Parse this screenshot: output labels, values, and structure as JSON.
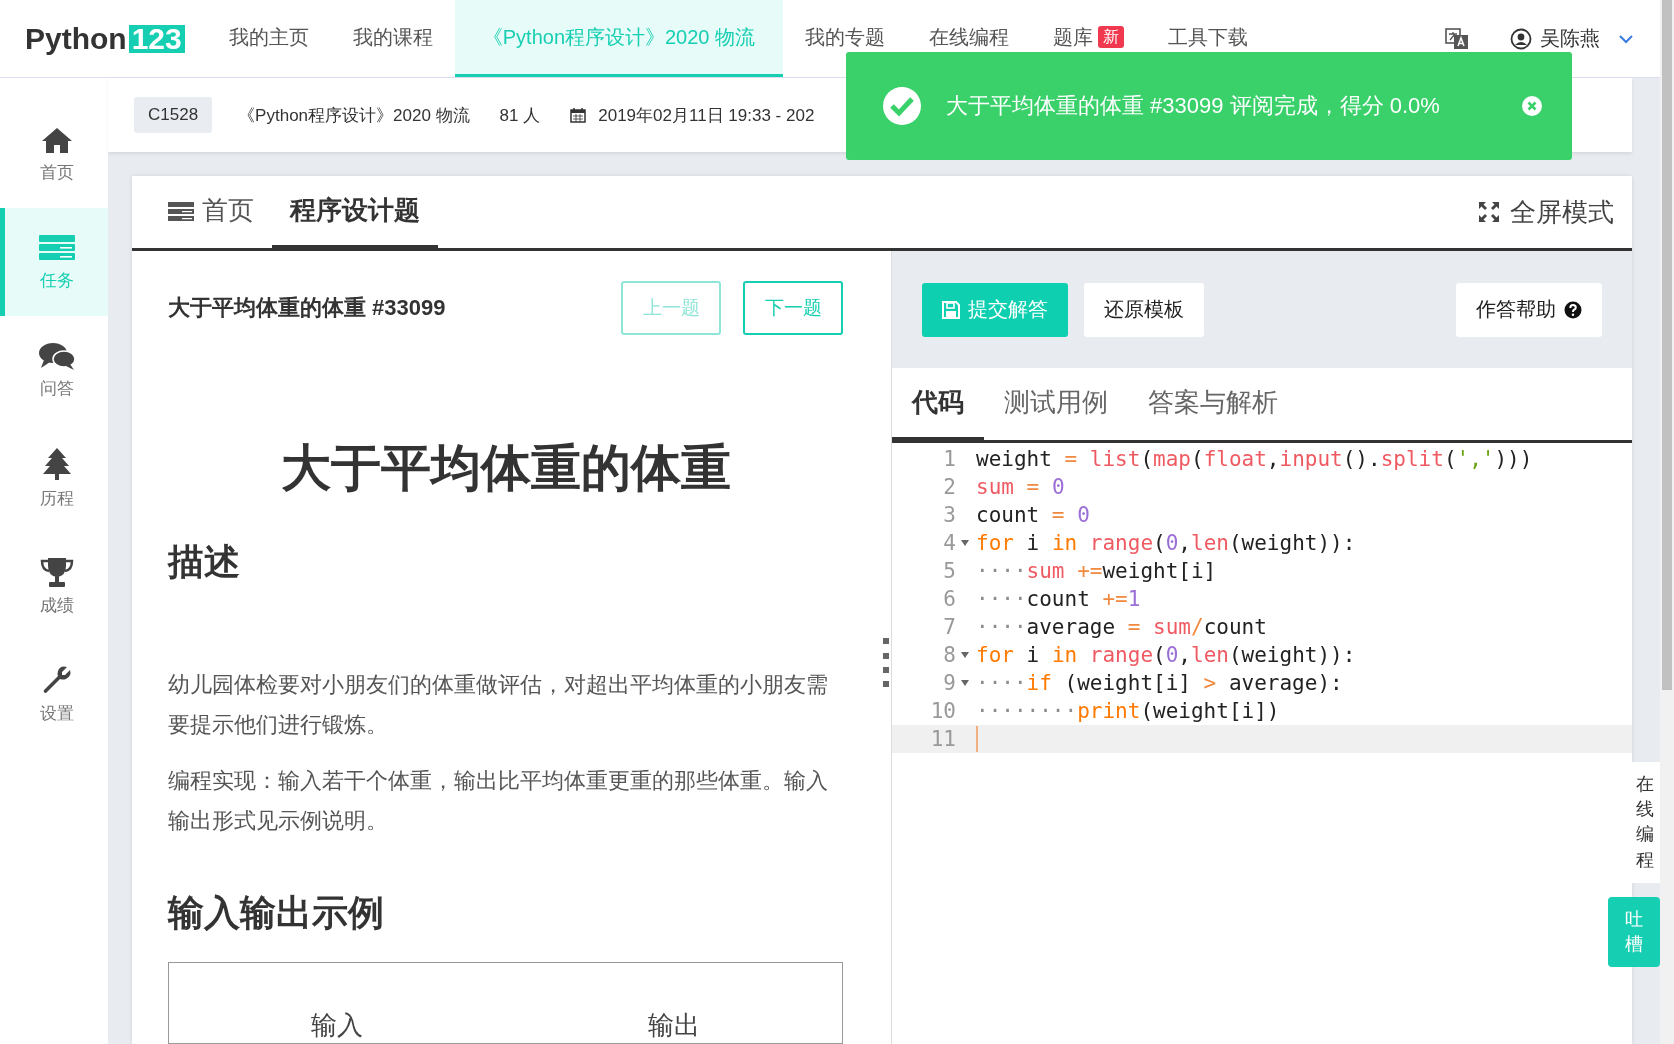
{
  "nav": {
    "logo": {
      "text": "Python",
      "badge": "123"
    },
    "items": [
      {
        "label": "我的主页",
        "selected": false
      },
      {
        "label": "我的课程",
        "selected": false
      },
      {
        "label": "《Python程序设计》2020 物流",
        "selected": true
      },
      {
        "label": "我的专题",
        "selected": false
      },
      {
        "label": "在线编程",
        "selected": false
      },
      {
        "label": "题库",
        "selected": false,
        "badge": "新"
      },
      {
        "label": "工具下载",
        "selected": false
      }
    ],
    "user": {
      "name": "吴陈燕"
    }
  },
  "sidebar": {
    "items": [
      {
        "label": "首页",
        "selected": false
      },
      {
        "label": "任务",
        "selected": true
      },
      {
        "label": "问答",
        "selected": false
      },
      {
        "label": "历程",
        "selected": false
      },
      {
        "label": "成绩",
        "selected": false
      },
      {
        "label": "设置",
        "selected": false
      }
    ]
  },
  "course_bar": {
    "code": "C1528",
    "course": "《Python程序设计》2020 物流",
    "members": "81 人",
    "dates": "2019年02月11日 19:33 - 202"
  },
  "toast": {
    "message": "大于平均体重的体重 #33099 评阅完成，得分 0.0%"
  },
  "card": {
    "tabs": [
      {
        "label": "首页",
        "selected": false
      },
      {
        "label": "程序设计题",
        "selected": true
      }
    ],
    "fullscreen": "全屏模式"
  },
  "problem": {
    "title": "大于平均体重的体重 #33099",
    "prev": {
      "label": "上一题",
      "disabled": true
    },
    "next": {
      "label": "下一题",
      "disabled": false
    },
    "heading": "大于平均体重的体重",
    "sections": [
      {
        "kind": "h2",
        "text": "描述"
      },
      {
        "kind": "p",
        "text": "幼儿园体检要对小朋友们的体重做评估，对超出平均体重的小朋友需要提示他们进行锻炼。"
      },
      {
        "kind": "p",
        "text": "编程实现：输入若干个体重，输出比平均体重更重的那些体重。输入输出形式见示例说明。"
      },
      {
        "kind": "h2",
        "text": "输入输出示例"
      }
    ],
    "example_table": {
      "columns": [
        "输入",
        "输出"
      ]
    }
  },
  "editor": {
    "toolbar": {
      "submit": "提交解答",
      "reset": "还原模板",
      "help": "作答帮助"
    },
    "tabs": [
      {
        "label": "代码",
        "selected": true
      },
      {
        "label": "测试用例",
        "selected": false
      },
      {
        "label": "答案与解析",
        "selected": false
      }
    ],
    "lines": [
      {
        "number": "1",
        "fold": false,
        "active": false,
        "tokens": [
          {
            "text": "weight",
            "kind": "plain"
          },
          {
            "text": " = ",
            "kind": "op"
          },
          {
            "text": "list",
            "kind": "builtin"
          },
          {
            "text": "(",
            "kind": "plain"
          },
          {
            "text": "map",
            "kind": "builtin"
          },
          {
            "text": "(",
            "kind": "plain"
          },
          {
            "text": "float",
            "kind": "builtin"
          },
          {
            "text": ",",
            "kind": "plain"
          },
          {
            "text": "input",
            "kind": "builtin"
          },
          {
            "text": "().",
            "kind": "plain"
          },
          {
            "text": "split",
            "kind": "builtin"
          },
          {
            "text": "(",
            "kind": "plain"
          },
          {
            "text": "','",
            "kind": "string"
          },
          {
            "text": ")))",
            "kind": "plain"
          }
        ]
      },
      {
        "number": "2",
        "fold": false,
        "active": false,
        "tokens": [
          {
            "text": "sum",
            "kind": "builtin"
          },
          {
            "text": " = ",
            "kind": "op"
          },
          {
            "text": "0",
            "kind": "number"
          }
        ]
      },
      {
        "number": "3",
        "fold": false,
        "active": false,
        "tokens": [
          {
            "text": "count",
            "kind": "plain"
          },
          {
            "text": " = ",
            "kind": "op"
          },
          {
            "text": "0",
            "kind": "number"
          }
        ]
      },
      {
        "number": "4",
        "fold": true,
        "active": false,
        "tokens": [
          {
            "text": "for",
            "kind": "keyword"
          },
          {
            "text": " i ",
            "kind": "plain"
          },
          {
            "text": "in",
            "kind": "keyword"
          },
          {
            "text": " range",
            "kind": "builtin"
          },
          {
            "text": "(",
            "kind": "plain"
          },
          {
            "text": "0",
            "kind": "number"
          },
          {
            "text": ",",
            "kind": "plain"
          },
          {
            "text": "len",
            "kind": "builtin"
          },
          {
            "text": "(weight)):",
            "kind": "plain"
          }
        ]
      },
      {
        "number": "5",
        "fold": false,
        "active": false,
        "tokens": [
          {
            "text": "····",
            "kind": "whitespace"
          },
          {
            "text": "sum",
            "kind": "builtin"
          },
          {
            "text": " +=",
            "kind": "op"
          },
          {
            "text": "weight[i]",
            "kind": "plain"
          }
        ]
      },
      {
        "number": "6",
        "fold": false,
        "active": false,
        "tokens": [
          {
            "text": "····",
            "kind": "whitespace"
          },
          {
            "text": "count",
            "kind": "plain"
          },
          {
            "text": " +=",
            "kind": "op"
          },
          {
            "text": "1",
            "kind": "number"
          }
        ]
      },
      {
        "number": "7",
        "fold": false,
        "active": false,
        "tokens": [
          {
            "text": "····",
            "kind": "whitespace"
          },
          {
            "text": "average",
            "kind": "plain"
          },
          {
            "text": " = ",
            "kind": "op"
          },
          {
            "text": "sum",
            "kind": "builtin"
          },
          {
            "text": "/",
            "kind": "op"
          },
          {
            "text": "count",
            "kind": "plain"
          }
        ]
      },
      {
        "number": "8",
        "fold": true,
        "active": false,
        "tokens": [
          {
            "text": "for",
            "kind": "keyword"
          },
          {
            "text": " i ",
            "kind": "plain"
          },
          {
            "text": "in",
            "kind": "keyword"
          },
          {
            "text": " range",
            "kind": "builtin"
          },
          {
            "text": "(",
            "kind": "plain"
          },
          {
            "text": "0",
            "kind": "number"
          },
          {
            "text": ",",
            "kind": "plain"
          },
          {
            "text": "len",
            "kind": "builtin"
          },
          {
            "text": "(weight)):",
            "kind": "plain"
          }
        ]
      },
      {
        "number": "9",
        "fold": true,
        "active": false,
        "tokens": [
          {
            "text": "····",
            "kind": "whitespace"
          },
          {
            "text": "if",
            "kind": "keyword"
          },
          {
            "text": " (weight[i] ",
            "kind": "plain"
          },
          {
            "text": ">",
            "kind": "op"
          },
          {
            "text": " average):",
            "kind": "plain"
          }
        ]
      },
      {
        "number": "10",
        "fold": false,
        "active": false,
        "tokens": [
          {
            "text": "········",
            "kind": "whitespace"
          },
          {
            "text": "print",
            "kind": "keyword"
          },
          {
            "text": "(weight[i])",
            "kind": "plain"
          }
        ]
      },
      {
        "number": "11",
        "fold": false,
        "active": true
      }
    ]
  },
  "side_float": {
    "online": "在线编程",
    "feedback": "吐槽"
  }
}
